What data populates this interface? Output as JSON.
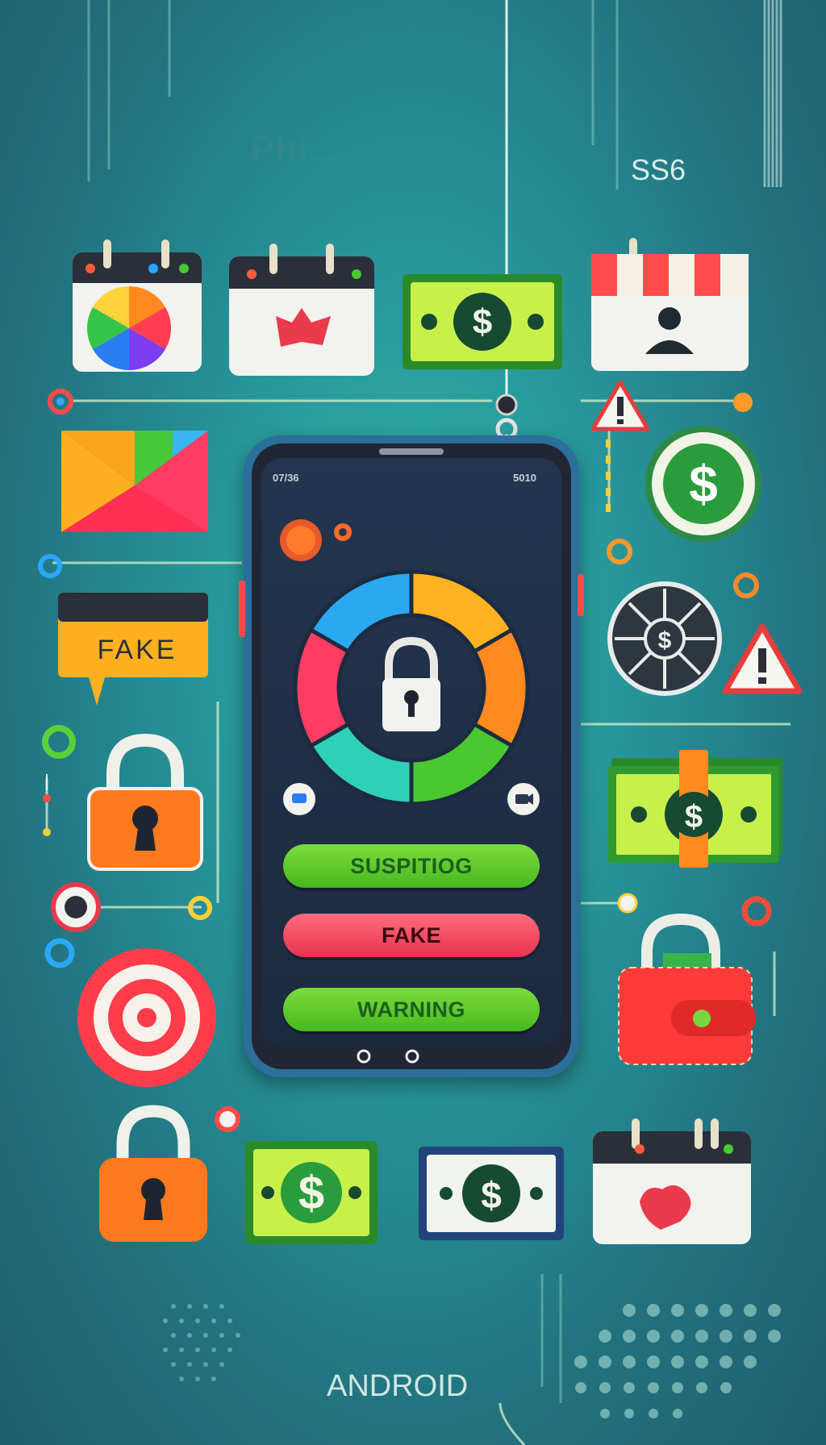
{
  "top": {
    "faded_title": "Phi...",
    "corner_code": "SS6"
  },
  "phone": {
    "status_left": "07/36",
    "status_right": "5010",
    "buttons": {
      "suspicious": "SUSPITIOG",
      "fake": "FAKE",
      "warning": "WARNING"
    }
  },
  "side_card": {
    "label": "FAKE"
  },
  "footer": {
    "label": "ANDROID"
  },
  "colors": {
    "accent_green": "#46b81e",
    "accent_red": "#e8334d",
    "phone_screen": "#1e3a58",
    "background": "#27979a"
  }
}
